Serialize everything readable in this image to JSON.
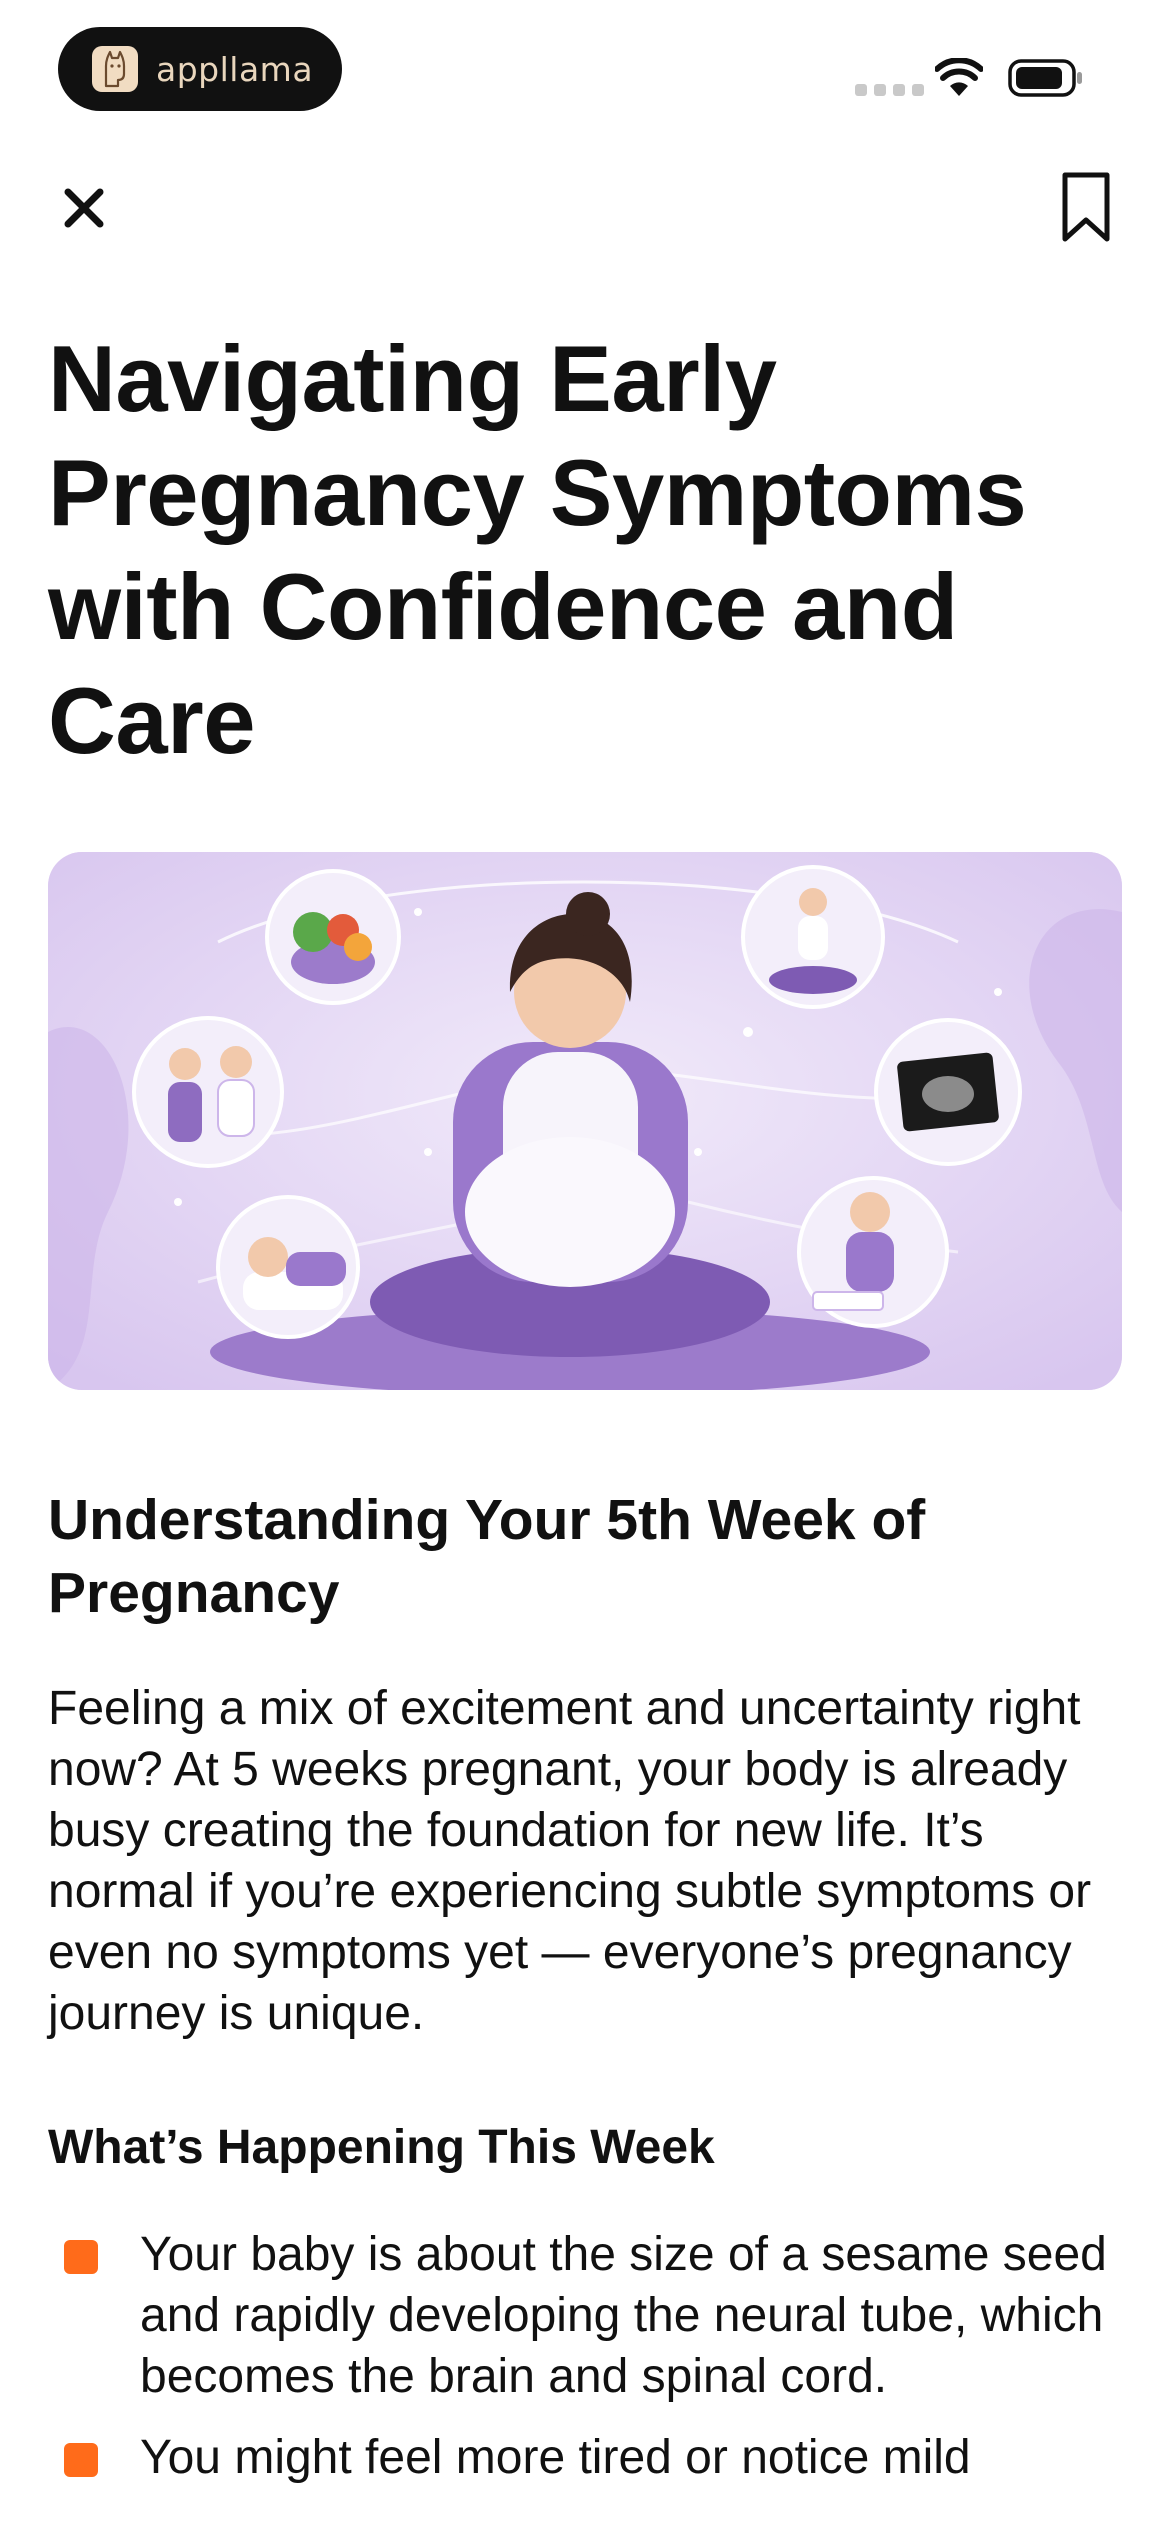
{
  "status_bar": {
    "brand_name": "appllama",
    "icons": [
      "appllama-logo-icon",
      "signal-icon",
      "wifi-icon",
      "battery-icon"
    ]
  },
  "nav": {
    "close_icon": "close-icon",
    "bookmark_icon": "bookmark-icon"
  },
  "article": {
    "title": "Navigating Early Pregnancy Symptoms with Confidence and Care",
    "section_title": "Understanding Your 5th Week of Pregnancy",
    "intro": "Feeling a mix of excitement and uncertainty right now? At 5 weeks pregnant, your body is already busy creating the foundation for new life. It’s normal if you’re experiencing subtle symptoms or even no symptoms yet — everyone’s pregnancy journey is unique.",
    "sub_title": "What’s Happening This Week",
    "bullets": [
      "Your baby is about the size of a sesame seed and rapidly developing the neural tube, which becomes the brain and spinal cord.",
      "You might feel more tired or notice mild"
    ]
  },
  "colors": {
    "accent": "#ff6b1a",
    "hero_background": "#e8dcf5",
    "hero_purple": "#8e6cc0"
  }
}
